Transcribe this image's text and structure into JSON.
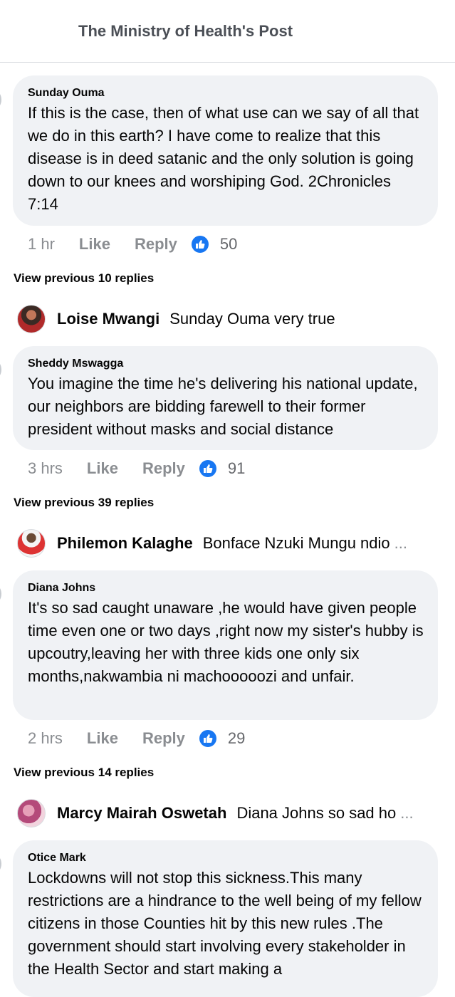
{
  "header": {
    "title": "The Ministry of Health's Post"
  },
  "comments": [
    {
      "author": "Sunday Ouma",
      "text": "If this is the case, then of what use can we say of all that we do in this earth? I have come to realize that this disease is in deed satanic and the only solution is going down to our knees and worshiping God. 2Chronicles 7:14",
      "time": "1 hr",
      "like_label": "Like",
      "reply_label": "Reply",
      "reactions": "50",
      "view_previous": "View previous 10 replies",
      "reply": {
        "name": "Loise Mwangi",
        "snippet": "Sunday Ouma very true",
        "ellipsis": ""
      }
    },
    {
      "author": "Sheddy Mswagga",
      "text": "You imagine the time he's delivering his national update, our neighbors are bidding farewell to their former president without masks and social distance",
      "time": "3 hrs",
      "like_label": "Like",
      "reply_label": "Reply",
      "reactions": "91",
      "view_previous": "View previous 39 replies",
      "reply": {
        "name": "Philemon Kalaghe",
        "snippet": "Bonface Nzuki Mungu ndio",
        "ellipsis": "..."
      }
    },
    {
      "author": "Diana Johns",
      "text": "It's  so sad caught unaware ,he would have given people time even one or two days ,right now my sister's hubby is upcoutry,leaving her with three kids one only six months,nakwambia ni machooooozi and unfair.",
      "time": "2 hrs",
      "like_label": "Like",
      "reply_label": "Reply",
      "reactions": "29",
      "view_previous": "View previous 14 replies",
      "reply": {
        "name": "Marcy Mairah Oswetah",
        "snippet": "Diana Johns so sad ho",
        "ellipsis": "..."
      }
    },
    {
      "author": "Otice Mark",
      "text": "Lockdowns will not stop this sickness.This many restrictions are a hindrance to the well being of my fellow citizens in those Counties hit by this new rules .The government should start involving every stakeholder in the Health Sector and start making a"
    }
  ],
  "colors": {
    "like_blue": "#1877f2",
    "bubble_bg": "#f0f2f5",
    "muted": "#8a8d91"
  }
}
